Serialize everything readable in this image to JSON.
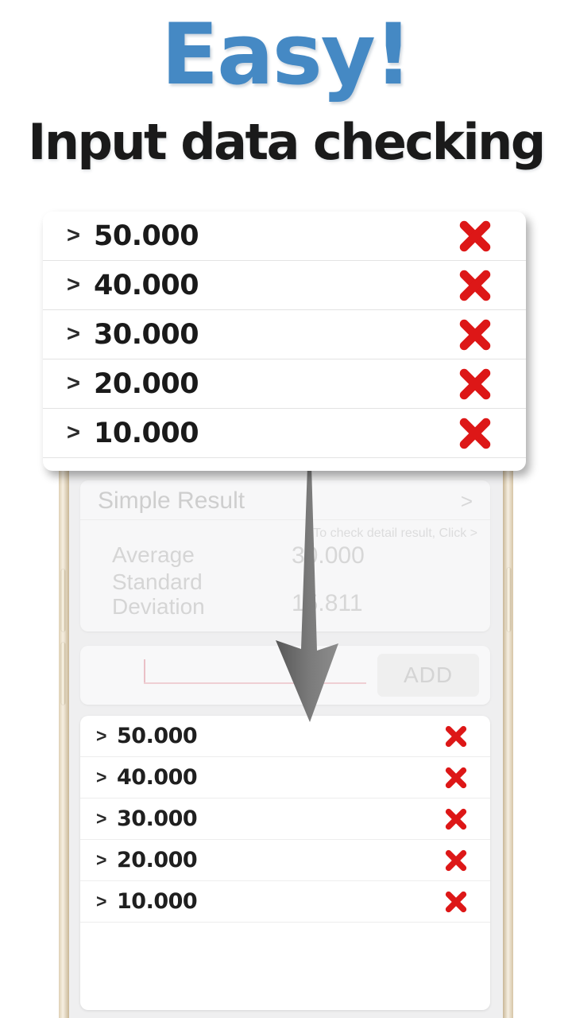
{
  "headline": {
    "accent_text": "Easy!",
    "accent_color": "#4589c4",
    "subtitle": "Input data checking"
  },
  "overlay_list": {
    "name": "zoomed-data-list",
    "delete_icon": "red-x-icon",
    "delete_color": "#dd1717",
    "chevron": ">",
    "rows": [
      {
        "chevron": ">",
        "value": "50.000"
      },
      {
        "chevron": ">",
        "value": "40.000"
      },
      {
        "chevron": ">",
        "value": "30.000"
      },
      {
        "chevron": ">",
        "value": "20.000"
      },
      {
        "chevron": ">",
        "value": "10.000"
      }
    ]
  },
  "arrow": {
    "icon": "down-arrow-icon",
    "color": "#6e6e6e",
    "direction": "down"
  },
  "phone": {
    "frame_color": "#e3d6ba",
    "screen_bg": "#efeff0",
    "buttons": {
      "volume_up": "volume-up-button",
      "volume_down": "volume-down-button",
      "power": "power-button"
    },
    "result_card": {
      "title": "Simple Result",
      "chevron": ">",
      "hint": "* To check detail result, Click >",
      "rows": [
        {
          "label": "Average",
          "value": "30.000"
        },
        {
          "label": "Standard Deviation",
          "value": "15.811"
        }
      ]
    },
    "input_row": {
      "field_value": "",
      "field_placeholder": "",
      "add_label": "ADD"
    },
    "data_list": {
      "delete_icon": "red-x-icon",
      "rows": [
        {
          "chevron": ">",
          "value": "50.000"
        },
        {
          "chevron": ">",
          "value": "40.000"
        },
        {
          "chevron": ">",
          "value": "30.000"
        },
        {
          "chevron": ">",
          "value": "20.000"
        },
        {
          "chevron": ">",
          "value": "10.000"
        }
      ]
    }
  }
}
